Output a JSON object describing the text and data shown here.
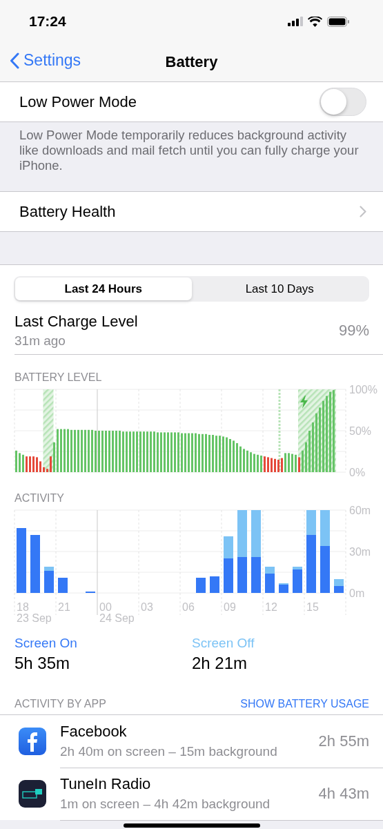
{
  "status_bar": {
    "time": "17:24"
  },
  "nav": {
    "back": "Settings",
    "title": "Battery"
  },
  "low_power": {
    "label": "Low Power Mode",
    "on": false,
    "footer": "Low Power Mode temporarily reduces background activity like downloads and mail fetch until you can fully charge your iPhone."
  },
  "battery_health": {
    "label": "Battery Health"
  },
  "segments": [
    {
      "label": "Last 24 Hours",
      "selected": true
    },
    {
      "label": "Last 10 Days",
      "selected": false
    }
  ],
  "last_charge": {
    "title": "Last Charge Level",
    "time": "31m ago",
    "value": "99%"
  },
  "battery_level": {
    "heading": "BATTERY LEVEL",
    "chart_data": {
      "type": "bar",
      "ylim": [
        0,
        100
      ],
      "yticks": [
        {
          "value": 0,
          "label": "0%"
        },
        {
          "value": 50,
          "label": "50%"
        },
        {
          "value": 100,
          "label": "100%"
        }
      ],
      "series": [
        {
          "color": "#65c466",
          "values": [
            26,
            23,
            21,
            null,
            null,
            null,
            null,
            null,
            null,
            null,
            null,
            36,
            52,
            52,
            52,
            52,
            51,
            51,
            51,
            51,
            51,
            51,
            51,
            50,
            50,
            50,
            50,
            50,
            50,
            50,
            50,
            49,
            49,
            49,
            49,
            49,
            49,
            49,
            49,
            49,
            49,
            48,
            48,
            48,
            48,
            48,
            48,
            48,
            47,
            47,
            47,
            47,
            47,
            46,
            46,
            46,
            45,
            45,
            44,
            44,
            43,
            42,
            40,
            38,
            35,
            31,
            28,
            26,
            24,
            22,
            21,
            20,
            null,
            null,
            null,
            null,
            null,
            null,
            23,
            23,
            22,
            21,
            null,
            26,
            36,
            50,
            60,
            71,
            78,
            86,
            92,
            97,
            99,
            null,
            null,
            null
          ]
        },
        {
          "color": "#e5493a",
          "values": [
            null,
            null,
            null,
            19,
            19,
            19,
            18,
            13,
            6,
            4,
            19,
            null,
            null,
            null,
            null,
            null,
            null,
            null,
            null,
            null,
            null,
            null,
            null,
            null,
            null,
            null,
            null,
            null,
            null,
            null,
            null,
            null,
            null,
            null,
            null,
            null,
            null,
            null,
            null,
            null,
            null,
            null,
            null,
            null,
            null,
            null,
            null,
            null,
            null,
            null,
            null,
            null,
            null,
            null,
            null,
            null,
            null,
            null,
            null,
            null,
            null,
            null,
            null,
            null,
            null,
            null,
            null,
            null,
            null,
            null,
            null,
            null,
            19,
            18,
            17,
            16,
            15,
            17,
            null,
            null,
            null,
            null,
            18,
            null,
            null,
            null,
            null,
            null,
            null,
            null,
            null,
            null,
            null,
            null,
            null,
            null
          ]
        }
      ]
    }
  },
  "activity": {
    "heading": "ACTIVITY",
    "chart_data": {
      "type": "bar",
      "stacked": true,
      "categories": [
        "18",
        null,
        null,
        "21",
        null,
        null,
        "00",
        null,
        null,
        "03",
        null,
        null,
        "06",
        null,
        null,
        "09",
        null,
        null,
        "12",
        null,
        null,
        "15",
        null,
        null
      ],
      "ylim": [
        0,
        60
      ],
      "yticks": [
        {
          "value": 0,
          "label": "0m"
        },
        {
          "value": 30,
          "label": "30m"
        },
        {
          "value": 60,
          "label": "60m"
        }
      ],
      "series": [
        {
          "color": "#3478f6",
          "values": [
            47,
            42,
            16,
            11,
            0,
            1,
            0,
            0,
            0,
            0,
            0,
            0,
            0,
            11,
            12,
            25,
            26,
            26,
            14,
            6,
            17,
            42,
            34,
            5
          ]
        },
        {
          "color": "#7cc3f5",
          "values": [
            0,
            0,
            3,
            0,
            0,
            0,
            0,
            0,
            0,
            0,
            0,
            0,
            0,
            0,
            0,
            16,
            34,
            34,
            5,
            1,
            2,
            18,
            26,
            5
          ]
        }
      ]
    },
    "dates": [
      "23 Sep",
      "24 Sep"
    ]
  },
  "totals": [
    {
      "label": "Screen On",
      "value": "5h 35m",
      "color": "#3478f6"
    },
    {
      "label": "Screen Off",
      "value": "2h 21m",
      "color": "#7cc3f5"
    }
  ],
  "apps_header": {
    "title": "ACTIVITY BY APP",
    "action": "SHOW BATTERY USAGE"
  },
  "apps": [
    {
      "kind": "facebook",
      "name": "Facebook",
      "detail": "2h 40m on screen – 15m background",
      "time": "2h 55m"
    },
    {
      "kind": "tunein",
      "name": "TuneIn Radio",
      "detail": "1m on screen – 4h 42m background",
      "time": "4h 43m"
    }
  ]
}
